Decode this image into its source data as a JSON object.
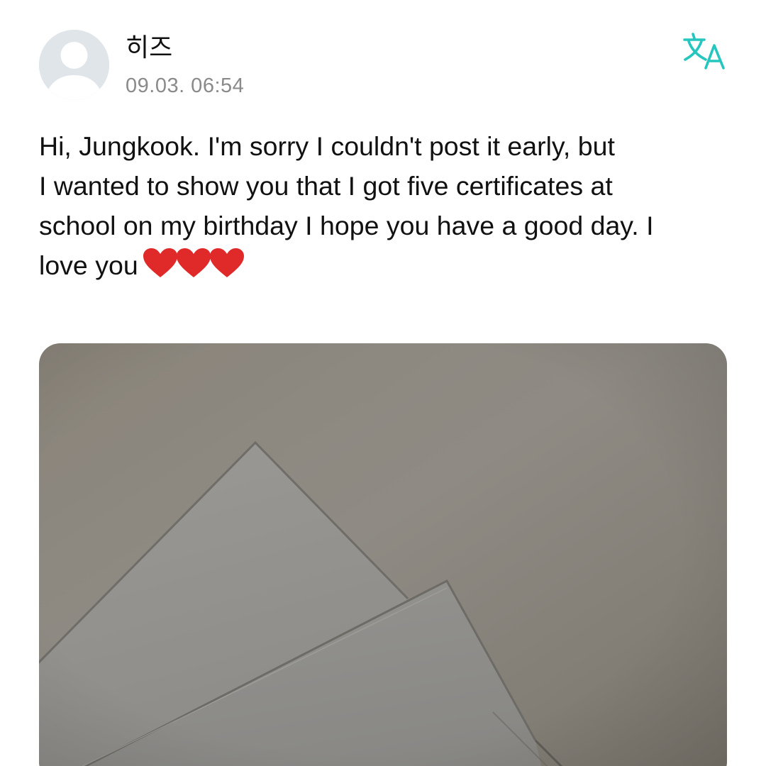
{
  "post": {
    "author_name": "히즈",
    "timestamp": "09.03. 06:54",
    "body_lines": [
      "Hi, Jungkook. I'm sorry I couldn't post it early, but",
      "I wanted to show you that I got five certificates at",
      "school on my birthday I hope you have a good day. I",
      "love you"
    ],
    "emoji": [
      "red-heart",
      "red-heart",
      "red-heart"
    ]
  },
  "icons": {
    "avatar": "default-user-avatar-icon",
    "translate": "translate-icon"
  },
  "colors": {
    "accent": "#26c6bf",
    "text": "#111111",
    "muted": "#8a8a8a",
    "avatar_bg": "#dfe5e8",
    "heart": "#e02a2a"
  }
}
